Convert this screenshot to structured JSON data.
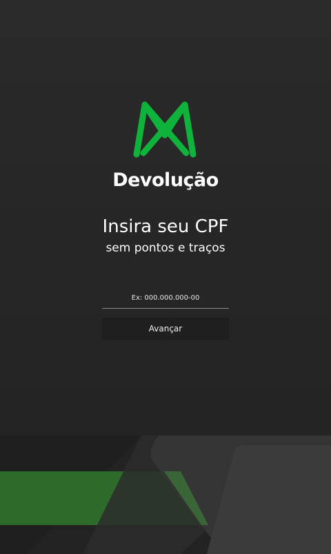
{
  "brand": {
    "logo_icon": "m-logo-icon",
    "logo_color": "#0fb33b",
    "title": "Devolução"
  },
  "form": {
    "heading": "Insira seu CPF",
    "subheading": "sem pontos e traços",
    "cpf_placeholder": "Ex: 000.000.000-00",
    "cpf_value": "",
    "submit_label": "Avançar"
  },
  "colors": {
    "background": "#262626",
    "accent_green": "#2e6b2a",
    "button_bg": "#1f1f1f"
  }
}
